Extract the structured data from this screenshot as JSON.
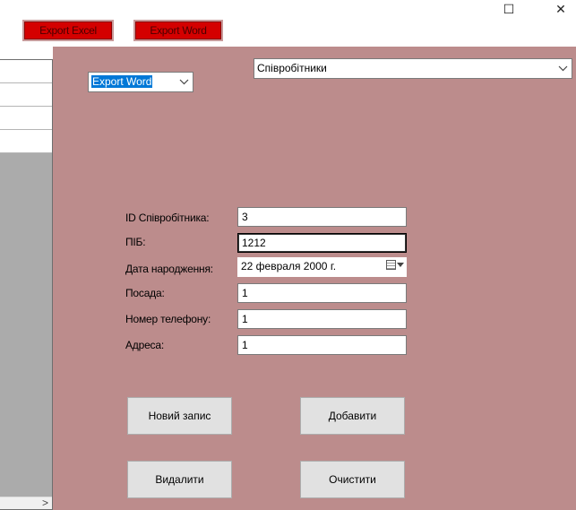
{
  "window": {
    "maximize_glyph": "☐",
    "close_glyph": "✕"
  },
  "toolbar": {
    "export_excel_label": "Export Excel",
    "export_word_label": "Export Word"
  },
  "form": {
    "export_combo_value": "Export Word",
    "table_combo_value": "Співробітники",
    "fields": [
      {
        "label": "ID Співробітника:",
        "value": "3"
      },
      {
        "label": "ПІБ:",
        "value": "1212"
      },
      {
        "label": "Дата народження:",
        "value": "22  февраля  2000 г."
      },
      {
        "label": "Посада:",
        "value": "1"
      },
      {
        "label": "Номер телефону:",
        "value": "1"
      },
      {
        "label": "Адреса:",
        "value": "1"
      }
    ],
    "buttons": {
      "new_record": "Новий запис",
      "add": "Добавити",
      "delete": "Видалити",
      "clear": "Очистити"
    }
  },
  "icons": {
    "chevron": "chevron-down-icon",
    "calendar": "calendar-icon",
    "scroll_right": "scroll-right-arrow-icon"
  },
  "colors": {
    "panel_bg": "#bc8c8c",
    "export_button_bg": "#d40000",
    "selection": "#0078d7"
  }
}
